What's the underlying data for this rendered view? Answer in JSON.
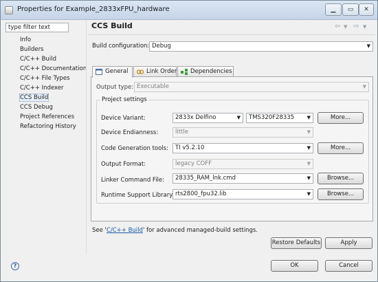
{
  "window": {
    "title": "Properties for Example_2833xFPU_hardware"
  },
  "nav": {
    "filter_text": "type filter text",
    "items": [
      {
        "label": "Info"
      },
      {
        "label": "Builders"
      },
      {
        "label": "C/C++ Build"
      },
      {
        "label": "C/C++ Documentation"
      },
      {
        "label": "C/C++ File Types"
      },
      {
        "label": "C/C++ Indexer"
      },
      {
        "label": "CCS Build"
      },
      {
        "label": "CCS Debug"
      },
      {
        "label": "Project References"
      },
      {
        "label": "Refactoring History"
      }
    ],
    "selected_index": 6
  },
  "page": {
    "title": "CCS Build",
    "build_config_label": "Build configuration:",
    "build_config_value": "Debug",
    "tabs": [
      {
        "label": "General",
        "icon": "general-tab-icon",
        "active": true
      },
      {
        "label": "Link Order",
        "icon": "link-order-icon",
        "active": false
      },
      {
        "label": "Dependencies",
        "icon": "dependencies-icon",
        "active": false
      }
    ],
    "output_type_label": "Output type:",
    "output_type_value": "Executable",
    "project_settings_title": "Project settings",
    "device_variant_label": "Device Variant:",
    "device_family_value": "2833x Delfino",
    "device_part_value": "TMS320F28335",
    "endianness_label": "Device Endianness:",
    "endianness_value": "little",
    "codegen_label": "Code Generation tools:",
    "codegen_value": "TI v5.2.10",
    "output_format_label": "Output Format:",
    "output_format_value": "legacy COFF",
    "linker_cmd_label": "Linker Command File:",
    "linker_cmd_value": "28335_RAM_lnk.cmd",
    "rts_label": "Runtime Support Library:",
    "rts_value": "rts2800_fpu32.lib",
    "more_label": "More...",
    "browse_label": "Browse...",
    "see_prefix": "See '",
    "see_link": "C/C++ Build",
    "see_suffix": "' for advanced managed-build settings.",
    "restore_defaults_label": "Restore Defaults",
    "apply_label": "Apply"
  },
  "footer": {
    "ok_label": "OK",
    "cancel_label": "Cancel",
    "help_glyph": "?"
  },
  "icons": {
    "titlebar": "app-icon",
    "help": "help-icon",
    "back": "back-arrow-icon",
    "forward": "forward-arrow-icon"
  }
}
